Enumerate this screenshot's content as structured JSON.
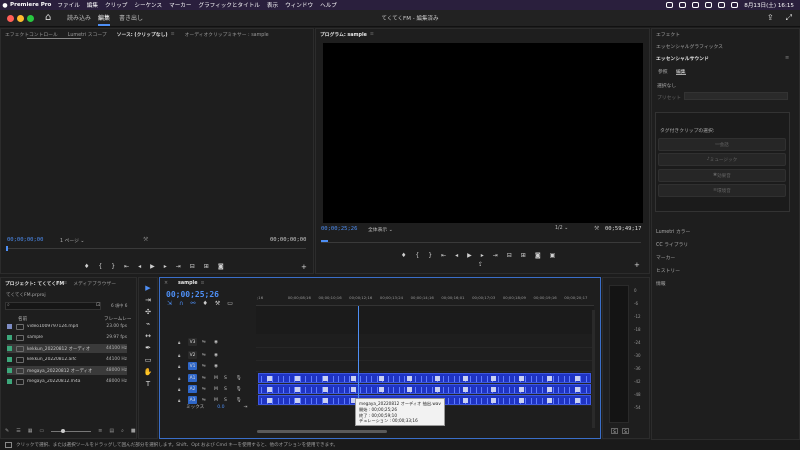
{
  "menubar": {
    "app": "Premiere Pro",
    "items": [
      "ファイル",
      "編集",
      "クリップ",
      "シーケンス",
      "マーカー",
      "グラフィックとタイトル",
      "表示",
      "ウィンドウ",
      "ヘルプ"
    ],
    "datetime": "8月13日(土)  16:15"
  },
  "header": {
    "workspaces": [
      "読み込み",
      "編集",
      "書き出し"
    ],
    "title": "てくてくFM - 編集済み"
  },
  "source_panel": {
    "tabs": [
      "エフェクトコントロール",
      "Lumetri スコープ",
      "ソース: (クリップなし)",
      "オーディオクリップミキサー : sample"
    ],
    "timecode_left": "00;00;00;00",
    "page": "1 ページ",
    "timecode_right": "00;00;00;00"
  },
  "program_panel": {
    "tab": "プログラム: sample",
    "timecode": "00;00;25;26",
    "fit": "全体表示",
    "resolution": "1/2",
    "duration": "00;59;49;17"
  },
  "right_panel": {
    "items": [
      "エフェクト",
      "エッセンシャルグラフィックス",
      "エッセンシャルサウンド"
    ],
    "tabs": [
      "参照",
      "編集"
    ],
    "selection": "選択なし",
    "preset": "プリセット",
    "assign_label": "タグ付きクリップの選択:",
    "buttons": [
      "会話",
      "ミュージック",
      "効果音",
      "環境音"
    ],
    "bottom_items": [
      "Lumetri カラー",
      "CC ライブラリ",
      "マーカー",
      "ヒストリー",
      "情報"
    ]
  },
  "project_panel": {
    "tabs": [
      "プロジェクト: てくてくFM",
      "メディアブラウザー"
    ],
    "file": "てくてくFM.prproj",
    "count": "6 項中 6",
    "col_name": "名前",
    "col_rate": "フレームレー",
    "items": [
      {
        "name": "video1009797124.mp4",
        "rate": "23.00 fps",
        "color": "#7d8cc4",
        "selected": false
      },
      {
        "name": "sample",
        "rate": "29.97 fps",
        "color": "#3da77b",
        "selected": false
      },
      {
        "name": "kekkun_20220812 オーディオ",
        "rate": "44100 Hz",
        "color": "#3da77b",
        "selected": true
      },
      {
        "name": "kekkun_20220812.aifc",
        "rate": "44100 Hz",
        "color": "#3da77b",
        "selected": false
      },
      {
        "name": "megaya_20220812 オーディオ",
        "rate": "48000 Hz",
        "color": "#3da77b",
        "selected": true
      },
      {
        "name": "megaya_20220812.m4a",
        "rate": "48000 Hz",
        "color": "#3da77b",
        "selected": false
      }
    ]
  },
  "timeline": {
    "tab": "sample",
    "timecode": "00;00;25;26",
    "ruler": [
      ";16",
      "00;00;08;16",
      "00;00;10;16",
      "00;00;12;16",
      "00;00;13;24",
      "00;00;14;16",
      "00;00;16;01",
      "00;00;17;03",
      "00;00;18;09",
      "00;00;19;16",
      "00;00;20;17"
    ],
    "tracks": [
      "V3",
      "V2",
      "V1",
      "A1",
      "A2",
      "A3"
    ],
    "mix_label": "ミックス",
    "mix_value": "0.0",
    "tooltip": {
      "line1": "megaya_20220812 オーディオ 抽出.wav",
      "line2": "開始 : 00;00;25;26",
      "line3": "終了 : 00;00;59;10",
      "line4": "デュレーション : 00;00;33;16"
    },
    "meter_labels": [
      "0",
      "-6",
      "-12",
      "-18",
      "-24",
      "-30",
      "-36",
      "-42",
      "-48",
      "-54"
    ],
    "meter_bottom": [
      "S",
      "S"
    ]
  },
  "status": "クリックで選択、または選択ツールをドラッグして囲んだ部分を選択します。Shift、Opt および Cmd キーを使用すると、他のオプションを使用できます。"
}
